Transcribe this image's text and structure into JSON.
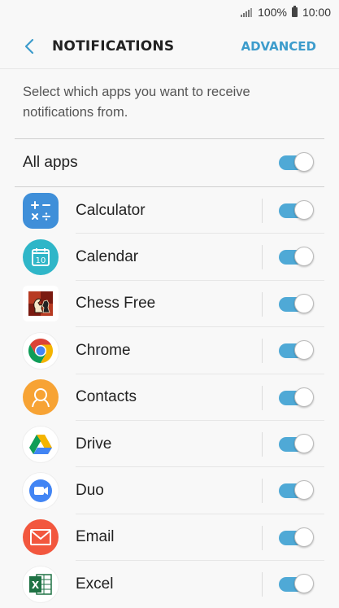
{
  "status_bar": {
    "battery": "100%",
    "time": "10:00"
  },
  "header": {
    "title": "NOTIFICATIONS",
    "advanced_label": "ADVANCED"
  },
  "description": "Select which apps you want to receive notifications from.",
  "all_apps": {
    "label": "All apps",
    "enabled": true
  },
  "apps": [
    {
      "name": "Calculator",
      "icon": "calculator-icon",
      "enabled": true
    },
    {
      "name": "Calendar",
      "icon": "calendar-icon",
      "enabled": true
    },
    {
      "name": "Chess Free",
      "icon": "chess-icon",
      "enabled": true
    },
    {
      "name": "Chrome",
      "icon": "chrome-icon",
      "enabled": true
    },
    {
      "name": "Contacts",
      "icon": "contacts-icon",
      "enabled": true
    },
    {
      "name": "Drive",
      "icon": "drive-icon",
      "enabled": true
    },
    {
      "name": "Duo",
      "icon": "duo-icon",
      "enabled": true
    },
    {
      "name": "Email",
      "icon": "email-icon",
      "enabled": true
    },
    {
      "name": "Excel",
      "icon": "excel-icon",
      "enabled": true
    }
  ],
  "colors": {
    "accent": "#4fa9d6",
    "link": "#3d9ccc"
  }
}
